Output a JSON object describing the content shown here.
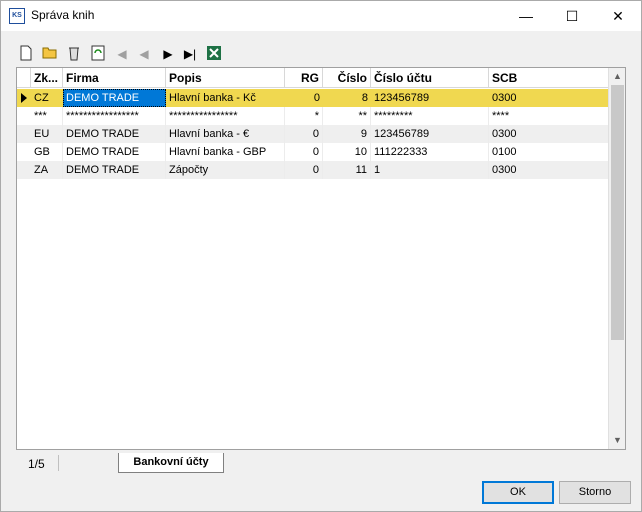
{
  "window": {
    "title": "Správa knih",
    "icon_text": "KS"
  },
  "toolbar": [
    "new-icon",
    "open-folder-icon",
    "delete-icon",
    "refresh-icon",
    "first-record-icon",
    "prev-record-icon",
    "next-record-icon",
    "last-record-icon",
    "excel-export-icon"
  ],
  "grid": {
    "columns": [
      "Zk...",
      "Firma",
      "Popis",
      "RG",
      "Číslo",
      "Číslo účtu",
      "SCB"
    ],
    "rows": [
      {
        "zk": "CZ",
        "firma": "DEMO TRADE",
        "popis": "Hlavní banka - Kč",
        "rg": "0",
        "cislo": "8",
        "ucet": "123456789",
        "scb": "0300",
        "selected": true
      },
      {
        "zk": "***",
        "firma": "*****************",
        "popis": "****************",
        "rg": "*",
        "cislo": "**",
        "ucet": "*********",
        "scb": "****",
        "selected": false
      },
      {
        "zk": "EU",
        "firma": "DEMO TRADE",
        "popis": "Hlavní banka - €",
        "rg": "0",
        "cislo": "9",
        "ucet": "123456789",
        "scb": "0300",
        "selected": false
      },
      {
        "zk": "GB",
        "firma": "DEMO TRADE",
        "popis": "Hlavní banka - GBP",
        "rg": "0",
        "cislo": "10",
        "ucet": "111222333",
        "scb": "0100",
        "selected": false
      },
      {
        "zk": "ZA",
        "firma": "DEMO TRADE",
        "popis": "Zápočty",
        "rg": "0",
        "cislo": "11",
        "ucet": "1",
        "scb": "0300",
        "selected": false
      }
    ]
  },
  "status": {
    "pager": "1/5",
    "tab_label": "Bankovní účty"
  },
  "buttons": {
    "ok": "OK",
    "cancel": "Storno"
  },
  "colors": {
    "selected_row": "#f0d850",
    "selected_cell": "#0078d7"
  }
}
